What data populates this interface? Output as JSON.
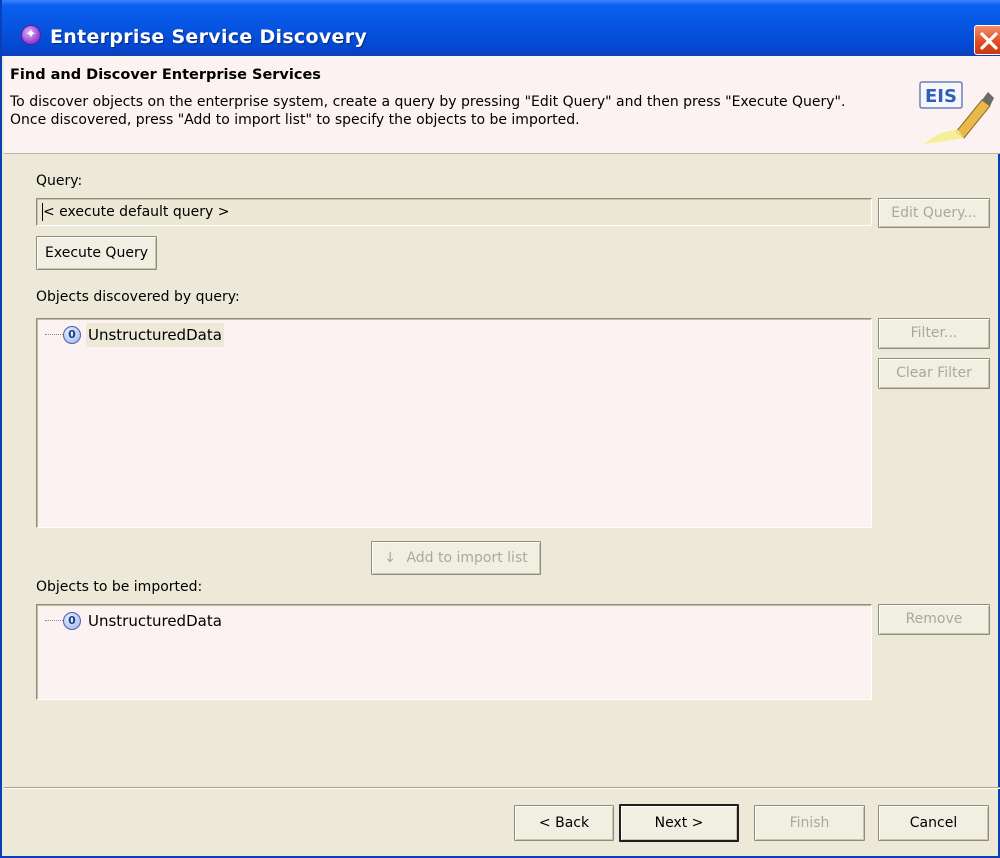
{
  "window": {
    "title": "Enterprise Service Discovery"
  },
  "banner": {
    "title": "Find and Discover Enterprise Services",
    "description": "To discover objects on the enterprise system, create a query by pressing \"Edit Query\" and then press \"Execute Query\". Once discovered, press \"Add to import list\" to specify the objects to be imported.",
    "logo_text": "EIS"
  },
  "query": {
    "label": "Query:",
    "value": "< execute default query >",
    "edit_button": "Edit Query...",
    "execute_button": "Execute Query"
  },
  "discovered": {
    "label": "Objects discovered by query:",
    "items": [
      {
        "icon": "object-node-icon",
        "icon_glyph": "0",
        "label": "UnstructuredData"
      }
    ],
    "filter_button": "Filter...",
    "clear_filter_button": "Clear Filter"
  },
  "add_to_import": {
    "arrow": "↓",
    "label": "Add to import list"
  },
  "imported": {
    "label": "Objects to be imported:",
    "items": [
      {
        "icon": "object-node-icon",
        "icon_glyph": "0",
        "label": "UnstructuredData"
      }
    ],
    "remove_button": "Remove"
  },
  "footer": {
    "back": "< Back",
    "next": "Next >",
    "finish": "Finish",
    "cancel": "Cancel"
  },
  "colors": {
    "titlebar": "#0654e0",
    "panel": "#ece9d8",
    "list_bg": "#fcf2f2",
    "disabled_text": "#aca899"
  }
}
